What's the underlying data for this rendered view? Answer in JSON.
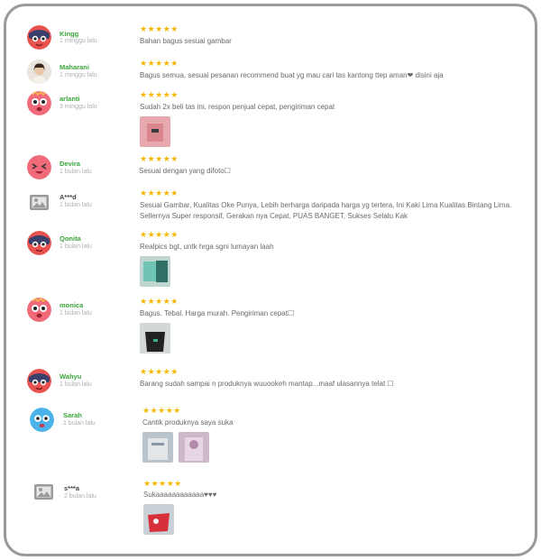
{
  "reviews": [
    {
      "user": "Kingg",
      "time": "1 minggu lalu",
      "stars": "★★★★★",
      "text": "Bahan bagus sesuai gambar",
      "avatar": "red-ninja-avatar"
    },
    {
      "user": "Maharani",
      "time": "1 minggu lalu",
      "stars": "★★★★★",
      "text": "Bagus semua, sesuai pesanan recommend buat yg mau cari tas kantong ttep aman❤ disini aja",
      "avatar": "user-photo-avatar"
    },
    {
      "user": "arlanti",
      "time": "3 minggu lalu",
      "stars": "★★★★★",
      "text": "Sudah 2x beli tas ini, respon penjual cepat, pengiriman cepat",
      "avatar": "pink-face-avatar"
    },
    {
      "user": "Devira",
      "time": "1 bulan lalu",
      "stars": "★★★★★",
      "text": "Sesuai dengan yang difoto☐",
      "avatar": "pink-squint-avatar"
    },
    {
      "user": "A***d",
      "time": "1 bulan lalu",
      "stars": "★★★★★",
      "text": "Sesuai Gambar, Kualitas Oke Punya, Lebih berharga daripada harga yg tertera, Ini Kaki Lima Kualitas Bintang Lima. Sellernya Super responsif, Gerakan nya Cepat, PUAS BANGET, Sukses Selalu Kak",
      "avatar": "placeholder-image-avatar"
    },
    {
      "user": "Qonita",
      "time": "1 bulan lalu",
      "stars": "★★★★★",
      "text": "Realpics bgt, untk hrga sgni lumayan laah",
      "avatar": "red-ninja-avatar"
    },
    {
      "user": "monica",
      "time": "1 bulan lalu",
      "stars": "★★★★★",
      "text": "Bagus. Tebal. Harga murah. Pengiriman cepat☐",
      "avatar": "pink-face-avatar"
    },
    {
      "user": "Wahyu",
      "time": "1 bulan lalu",
      "stars": "★★★★★",
      "text": "Barang sudah sampai n produknya wuuookeh mantap...maaf ulasannya telat ☐",
      "avatar": "red-ninja-avatar"
    },
    {
      "user": "Sarah",
      "time": "1 bulan lalu",
      "stars": "★★★★★",
      "text": "Cantik produknya saya suka",
      "avatar": "blue-face-avatar"
    },
    {
      "user": "s***a",
      "time": "2 bulan lalu",
      "stars": "★★★★★",
      "text": "Sukaaaaaaaaaaaa♥♥♥",
      "avatar": "placeholder-image-avatar"
    }
  ],
  "colors": {
    "username": "#3aa63a",
    "star": "#f5b800",
    "text": "#6a6a6a",
    "time": "#b0b0b0"
  }
}
